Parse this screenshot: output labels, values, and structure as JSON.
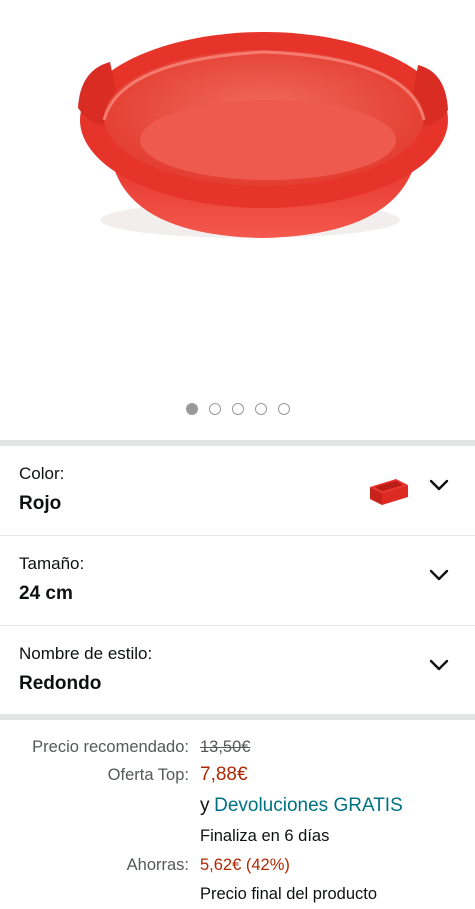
{
  "gallery": {
    "image_icon": "red-silicone-round-cake-pan",
    "dot_count": 5,
    "active_index": 0
  },
  "variations": [
    {
      "label": "Color:",
      "value": "Rojo",
      "swatch_icon": "red-cake-mold-thumbnail"
    },
    {
      "label": "Tamaño:",
      "value": "24 cm"
    },
    {
      "label": "Nombre de estilo:",
      "value": "Redondo"
    }
  ],
  "pricing": {
    "recommended_label": "Precio recomendado:",
    "recommended_price": "13,50€",
    "offer_label": "Oferta Top:",
    "offer_price": "7,88€",
    "returns_prefix": "y",
    "returns_link": "Devoluciones GRATIS",
    "deal_ends": "Finaliza en 6 días",
    "savings_label": "Ahorras:",
    "savings_value": "5,62€ (42%)",
    "final_price_note": "Precio final del producto"
  },
  "colors": {
    "price_red": "#b12704",
    "link_teal": "#007185",
    "product_red": "#e8302a"
  }
}
